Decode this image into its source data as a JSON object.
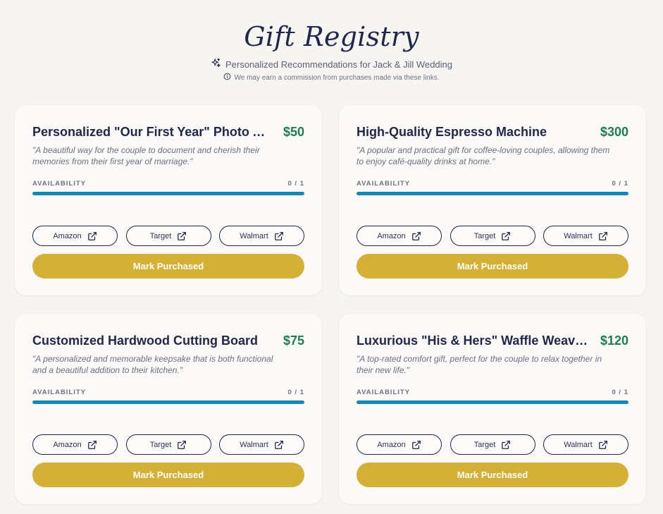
{
  "header": {
    "title": "Gift Registry",
    "subtitle": "Personalized Recommendations for Jack & Jill Wedding",
    "note": "We may earn a commission from purchases made via these links."
  },
  "availability_label": "AVAILABILITY",
  "mark_label": "Mark Purchased",
  "retailers": [
    "Amazon",
    "Target",
    "Walmart"
  ],
  "colors": {
    "accent_gold": "#d5b036",
    "price_green": "#1d7b55",
    "bar_blue": "#1089b8",
    "navy": "#1f2649"
  },
  "cards": [
    {
      "title": "Personalized \"Our First Year\" Photo Album",
      "price": "$50",
      "description": "\"A beautiful way for the couple to document and cherish their memories from their first year of marriage.\"",
      "count": "0 / 1",
      "progress": 1.0
    },
    {
      "title": "High-Quality Espresso Machine",
      "price": "$300",
      "description": "\"A popular and practical gift for coffee-loving couples, allowing them to enjoy café-quality drinks at home.\"",
      "count": "0 / 1",
      "progress": 1.0
    },
    {
      "title": "Customized Hardwood Cutting Board",
      "price": "$75",
      "description": "\"A personalized and memorable keepsake that is both functional and a beautiful addition to their kitchen.\"",
      "count": "0 / 1",
      "progress": 1.0
    },
    {
      "title": "Luxurious \"His & Hers\" Waffle Weave Robes",
      "price": "$120",
      "description": "\"A top-rated comfort gift, perfect for the couple to relax together in their new life.\"",
      "count": "0 / 1",
      "progress": 1.0
    }
  ]
}
